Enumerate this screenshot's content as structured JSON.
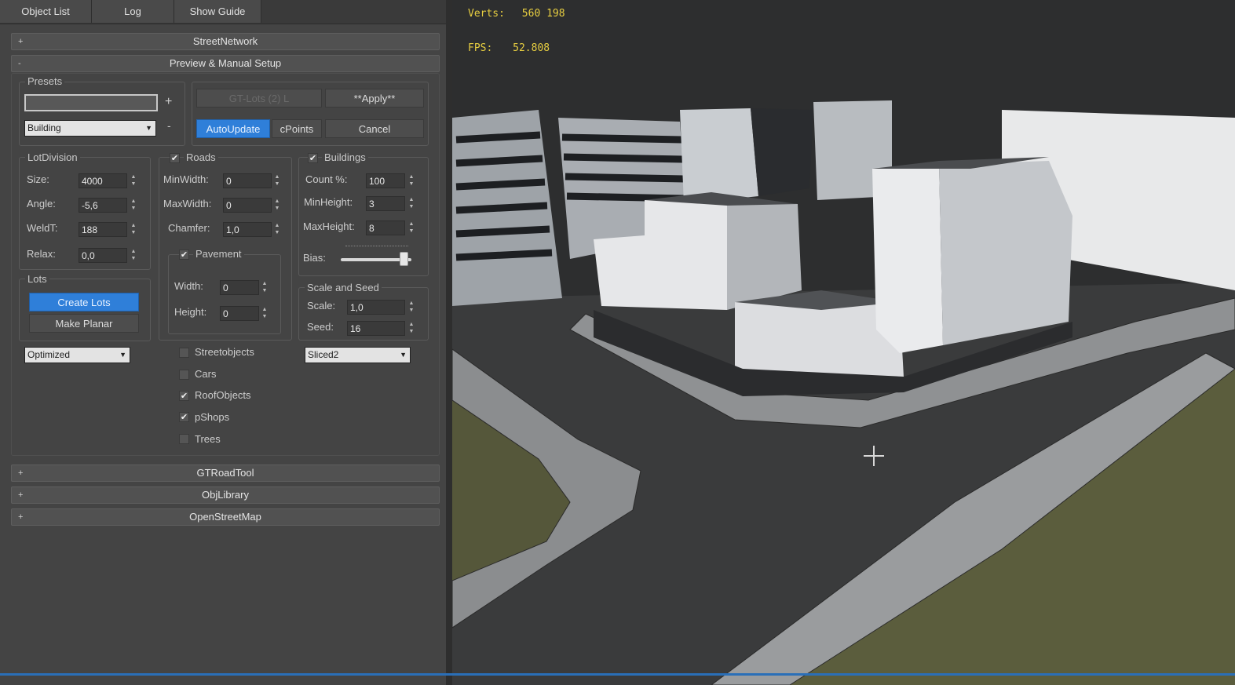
{
  "tabs": [
    "Object List",
    "Log",
    "Show Guide"
  ],
  "rollouts": {
    "street_network": "StreetNetwork",
    "preview": "Preview & Manual Setup",
    "gtroadtool": "GTRoadTool",
    "objlibrary": "ObjLibrary",
    "openstreetmap": "OpenStreetMap"
  },
  "presets": {
    "title": "Presets",
    "name_value": "",
    "add_label": "+",
    "remove_label": "-",
    "type_value": "Building"
  },
  "buttons": {
    "greyed": "GT-Lots (2) L",
    "apply": "**Apply**",
    "autoupdate": "AutoUpdate",
    "cpoints": "cPoints",
    "cancel": "Cancel",
    "create_lots": "Create Lots",
    "make_planar": "Make Planar"
  },
  "lot_division": {
    "title": "LotDivision",
    "size_label": "Size:",
    "size": "4000",
    "angle_label": "Angle:",
    "angle": "-5,6",
    "weld_label": "WeldT:",
    "weld": "188",
    "relax_label": "Relax:",
    "relax": "0,0"
  },
  "lots": {
    "title": "Lots",
    "mode": "Optimized"
  },
  "roads": {
    "title": "Roads",
    "checked": true,
    "minwidth_label": "MinWidth:",
    "minwidth": "0",
    "maxwidth_label": "MaxWidth:",
    "maxwidth": "0",
    "chamfer_label": "Chamfer:",
    "chamfer": "1,0"
  },
  "pavement": {
    "title": "Pavement",
    "checked": true,
    "width_label": "Width:",
    "width": "0",
    "height_label": "Height:",
    "height": "0"
  },
  "buildings": {
    "title": "Buildings",
    "checked": true,
    "count_label": "Count %:",
    "count": "100",
    "minheight_label": "MinHeight:",
    "minheight": "3",
    "maxheight_label": "MaxHeight:",
    "maxheight": "8",
    "bias_label": "Bias:",
    "bias_fraction": 0.95
  },
  "scale_seed": {
    "title": "Scale and Seed",
    "scale_label": "Scale:",
    "scale": "1,0",
    "seed_label": "Seed:",
    "seed": "16",
    "mode": "Sliced2"
  },
  "objects": [
    {
      "label": "Streetobjects",
      "checked": false
    },
    {
      "label": "Cars",
      "checked": false
    },
    {
      "label": "RoofObjects",
      "checked": true
    },
    {
      "label": "pShops",
      "checked": true
    },
    {
      "label": "Trees",
      "checked": false
    }
  ],
  "viewport": {
    "verts_label": "Verts:",
    "verts": "560 198",
    "fps_label": "FPS:",
    "fps": "52.808",
    "stats_color": "#e8cf41"
  }
}
